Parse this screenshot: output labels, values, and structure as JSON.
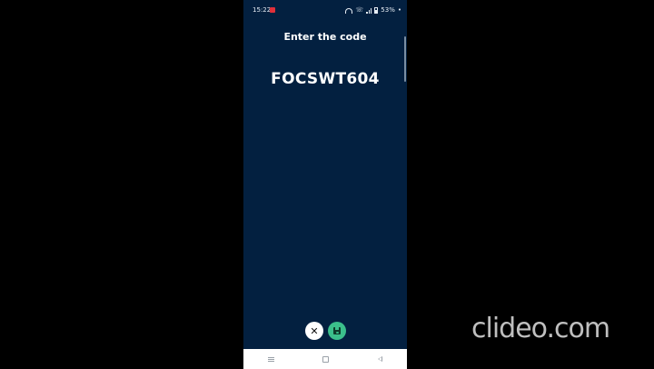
{
  "status_bar": {
    "time": "15:22",
    "battery_percent": "53%",
    "icons": [
      "notification-app-icon",
      "wifi-icon",
      "call-icon",
      "signal-icon",
      "battery-icon"
    ]
  },
  "screen": {
    "title": "Enter the code",
    "code": "FOCSWT604",
    "background_color": "#032040"
  },
  "actions": {
    "close_icon": "close-icon",
    "save_icon": "save-icon",
    "close_glyph": "✕",
    "save_color": "#3bbf8b"
  },
  "nav_bar": {
    "icons": [
      "recents-icon",
      "home-icon",
      "back-icon"
    ]
  },
  "watermark": "clideo.com"
}
